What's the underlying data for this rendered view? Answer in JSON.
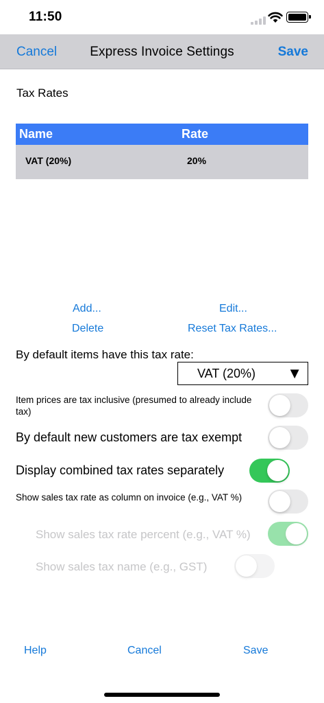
{
  "status_bar": {
    "time": "11:50"
  },
  "nav": {
    "cancel_label": "Cancel",
    "title": "Express Invoice Settings",
    "save_label": "Save"
  },
  "section_title": "Tax Rates",
  "tax_table": {
    "columns": [
      "Name",
      "Rate"
    ],
    "rows": [
      {
        "name": "VAT (20%)",
        "rate": "20%"
      }
    ],
    "header_color": "#3b7cf6"
  },
  "actions": {
    "add": "Add...",
    "edit": "Edit...",
    "delete": "Delete",
    "reset": "Reset Tax Rates..."
  },
  "default_rate": {
    "label": "By default items have this tax rate:",
    "selected": "VAT (20%)",
    "arrow": "▼"
  },
  "options": [
    {
      "label": "Item prices are tax inclusive (presumed to already include tax)",
      "on": false,
      "enabled": true
    },
    {
      "label": "By default new customers are tax exempt",
      "on": false,
      "enabled": true
    },
    {
      "label": "Display combined tax rates separately",
      "on": true,
      "enabled": true
    },
    {
      "label": "Show sales tax rate as column on invoice  (e.g., VAT %)",
      "on": false,
      "enabled": true
    },
    {
      "label": "Show sales tax rate percent (e.g., VAT %)",
      "on": true,
      "enabled": false
    },
    {
      "label": "Show sales tax name (e.g., GST)",
      "on": false,
      "enabled": false
    }
  ],
  "footer": {
    "help": "Help",
    "cancel": "Cancel",
    "save": "Save"
  },
  "colors": {
    "accent": "#1579d9",
    "toggle_on": "#34c759",
    "nav_bg": "#d0d0d4"
  }
}
